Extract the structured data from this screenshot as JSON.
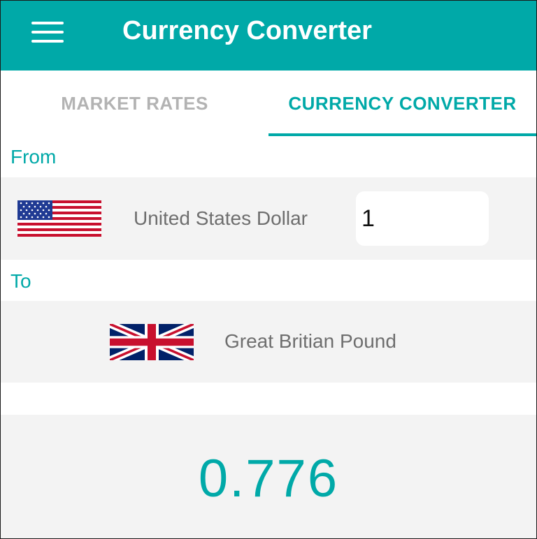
{
  "app": {
    "title": "Currency Converter",
    "accent_color": "#00a9a8",
    "menu_icon": "hamburger-menu-icon"
  },
  "tabs": [
    {
      "label": "MARKET RATES",
      "active": false
    },
    {
      "label": "CURRENCY CONVERTER",
      "active": true
    }
  ],
  "from": {
    "label": "From",
    "flag_icon": "us-flag-icon",
    "currency_name": "United States Dollar",
    "amount": "1"
  },
  "to": {
    "label": "To",
    "flag_icon": "gb-flag-icon",
    "currency_name": "Great Britian Pound"
  },
  "result": {
    "value": "0.776"
  }
}
